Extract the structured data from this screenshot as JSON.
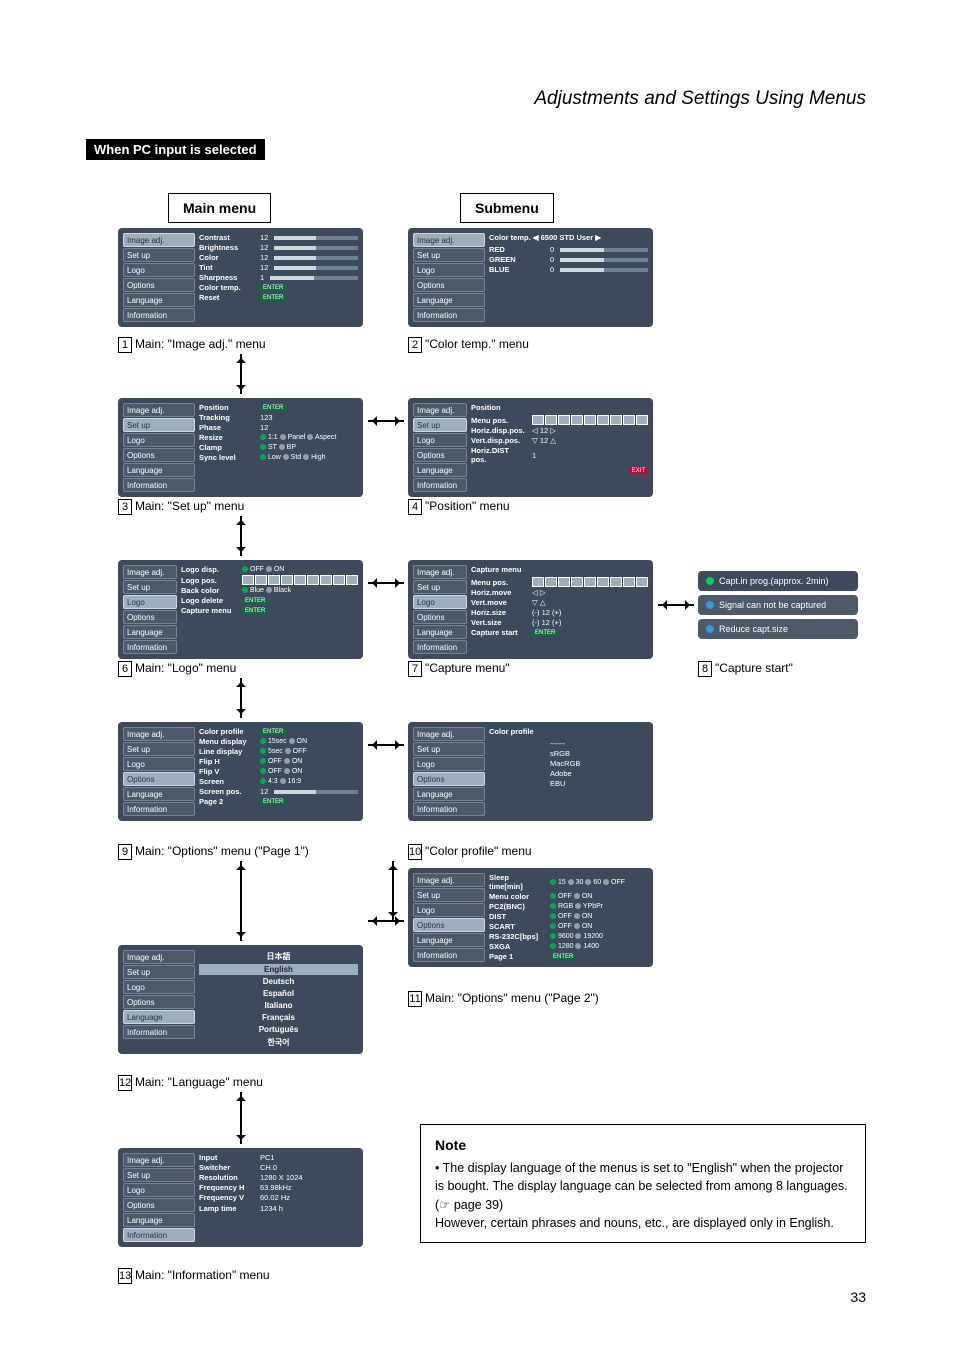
{
  "header": {
    "section_title": "Adjustments and Settings Using Menus"
  },
  "badge": {
    "when_pc": "When PC input is selected"
  },
  "col_labels": {
    "main": "Main menu",
    "sub": "Submenu"
  },
  "side_items": [
    "Image adj.",
    "Set up",
    "Logo",
    "Options",
    "Language",
    "Information"
  ],
  "panels": {
    "p1": {
      "rows": [
        {
          "k": "Contrast",
          "v": "12",
          "bar": true
        },
        {
          "k": "Brightness",
          "v": "12",
          "bar": true
        },
        {
          "k": "Color",
          "v": "12",
          "bar": true
        },
        {
          "k": "Tint",
          "v": "12",
          "bar": true
        },
        {
          "k": "Sharpness",
          "v": "1",
          "bar": true
        },
        {
          "k": "Color temp.",
          "btn": "ENTER"
        },
        {
          "k": "Reset",
          "btn": "ENTER"
        }
      ],
      "caption": "Main: \"Image adj.\" menu",
      "num": "1"
    },
    "p2": {
      "head": "Color temp. ◀ 6500 STD User ▶",
      "rows": [
        {
          "k": "RED",
          "v": "0",
          "bar": true
        },
        {
          "k": "GREEN",
          "v": "0",
          "bar": true
        },
        {
          "k": "BLUE",
          "v": "0",
          "bar": true
        }
      ],
      "caption": "\"Color temp.\" menu",
      "num": "2"
    },
    "p3": {
      "rows": [
        {
          "k": "Position",
          "btn": "ENTER"
        },
        {
          "k": "Tracking",
          "v": "123"
        },
        {
          "k": "Phase",
          "v": "12"
        },
        {
          "k": "Resize",
          "opts": "1:1   Panel   Aspect"
        },
        {
          "k": "Clamp",
          "opts": "ST   BP"
        },
        {
          "k": "Sync level",
          "opts": "Low   Std   High"
        }
      ],
      "caption": "Main: \"Set up\" menu",
      "num": "3"
    },
    "p4": {
      "head": "Position",
      "rows": [
        {
          "k": "Menu pos.",
          "pos": true
        },
        {
          "k": "Horiz.disp.pos.",
          "v": "◁   12   ▷"
        },
        {
          "k": "Vert.disp.pos.",
          "v": "▽   12   △"
        },
        {
          "k": "Horiz.DIST pos.",
          "v": "1"
        }
      ],
      "exit": true,
      "caption": "\"Position\" menu",
      "num": "4"
    },
    "p6": {
      "rows": [
        {
          "k": "Logo disp.",
          "opts": "OFF   ON"
        },
        {
          "k": "Logo pos.",
          "pos": true
        },
        {
          "k": "Back color",
          "opts": "Blue   Black"
        },
        {
          "k": "Logo delete",
          "btn": "ENTER"
        },
        {
          "k": "Capture menu",
          "btn": "ENTER"
        }
      ],
      "caption": "Main: \"Logo\" menu",
      "num": "6"
    },
    "p7": {
      "head": "Capture menu",
      "rows": [
        {
          "k": "Menu pos.",
          "pos": true
        },
        {
          "k": "Horiz.move",
          "v": "◁        ▷"
        },
        {
          "k": "Vert.move",
          "v": "▽        △"
        },
        {
          "k": "Horiz.size",
          "v": "(-)   12   (+)"
        },
        {
          "k": "Vert.size",
          "v": "(-)   12   (+)"
        },
        {
          "k": "Capture start",
          "btn": "ENTER"
        }
      ],
      "caption": "\"Capture menu\"",
      "num": "7"
    },
    "p8": {
      "lines": [
        "Capt.in prog.(approx. 2min)",
        "Signal can not be captured",
        "Reduce capt.size"
      ],
      "caption": "\"Capture start\"",
      "num": "8"
    },
    "p9": {
      "rows": [
        {
          "k": "Color profile",
          "btn": "ENTER"
        },
        {
          "k": "Menu display",
          "opts": "15sec   ON"
        },
        {
          "k": "Line display",
          "opts": "5sec   OFF"
        },
        {
          "k": "Flip H",
          "opts": "OFF   ON"
        },
        {
          "k": "Flip V",
          "opts": "OFF   ON"
        },
        {
          "k": "Screen",
          "opts": "4:3   16:9"
        },
        {
          "k": "Screen pos.",
          "v": "12",
          "bar": true
        },
        {
          "k": "Page 2",
          "btn": "ENTER"
        }
      ],
      "caption": "Main: \"Options\" menu (\"Page 1\")",
      "num": "9"
    },
    "p10": {
      "head": "Color profile",
      "rows": [
        {
          "k": "",
          "v": "------"
        },
        {
          "k": "",
          "v": "sRGB"
        },
        {
          "k": "",
          "v": "MacRGB"
        },
        {
          "k": "",
          "v": "Adobe"
        },
        {
          "k": "",
          "v": "EBU"
        }
      ],
      "caption": "\"Color profile\" menu",
      "num": "10"
    },
    "p11": {
      "rows": [
        {
          "k": "Sleep time[min]",
          "opts": "15  30  60  OFF"
        },
        {
          "k": "Menu color",
          "opts": "OFF   ON"
        },
        {
          "k": "PC2(BNC)",
          "opts": "RGB   YPbPr"
        },
        {
          "k": "DIST",
          "opts": "OFF   ON"
        },
        {
          "k": "SCART",
          "opts": "OFF   ON"
        },
        {
          "k": "RS-232C[bps]",
          "opts": "9600   19200"
        },
        {
          "k": "SXGA",
          "opts": "1280   1400"
        },
        {
          "k": "Page 1",
          "btn": "ENTER"
        }
      ],
      "caption": "Main: \"Options\" menu (\"Page 2\")",
      "num": "11"
    },
    "p12": {
      "langs": [
        "日本語",
        "English",
        "Deutsch",
        "Español",
        "Italiano",
        "Français",
        "Português",
        "한국어"
      ],
      "caption": "Main: \"Language\" menu",
      "num": "12"
    },
    "p13": {
      "rows": [
        {
          "k": "Input",
          "v": "PC1"
        },
        {
          "k": "Switcher",
          "v": "CH.0"
        },
        {
          "k": "Resolution",
          "v": "1280 X 1024"
        },
        {
          "k": "Frequency H",
          "v": "63.98kHz"
        },
        {
          "k": "Frequency V",
          "v": "60.02 Hz"
        },
        {
          "k": "",
          "v": ""
        },
        {
          "k": "Lamp time",
          "v": "1234 h"
        }
      ],
      "caption": "Main: \"Information\" menu",
      "num": "13"
    }
  },
  "note": {
    "title": "Note",
    "body": "• The display language of the menus is set to \"English\" when the projector is bought. The display language can be selected from among 8 languages. (☞ page 39)\nHowever, certain phrases and nouns, etc., are displayed only in English."
  },
  "page_number": "33"
}
